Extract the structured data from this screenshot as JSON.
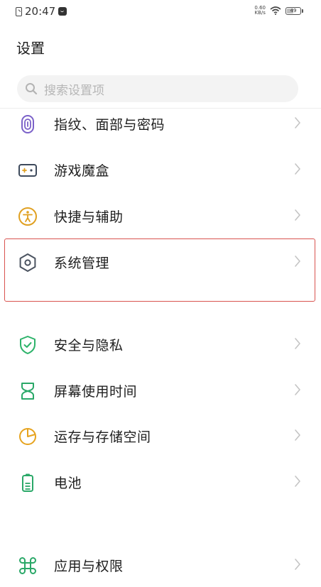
{
  "status_bar": {
    "time": "20:47",
    "net_speed_value": "0.60",
    "net_speed_unit": "KB/s",
    "battery": "49"
  },
  "page": {
    "title": "设置"
  },
  "search": {
    "placeholder": "搜索设置项"
  },
  "settings": {
    "items": [
      {
        "label": "指纹、面部与密码",
        "icon": "fingerprint-icon"
      },
      {
        "label": "游戏魔盒",
        "icon": "gamepad-icon"
      },
      {
        "label": "快捷与辅助",
        "icon": "accessibility-icon"
      },
      {
        "label": "系统管理",
        "icon": "hexagon-settings-icon",
        "highlighted": true
      },
      {
        "label": "安全与隐私",
        "icon": "shield-check-icon"
      },
      {
        "label": "屏幕使用时间",
        "icon": "hourglass-icon"
      },
      {
        "label": "运存与存储空间",
        "icon": "pie-chart-icon"
      },
      {
        "label": "电池",
        "icon": "battery-icon"
      },
      {
        "label": "应用与权限",
        "icon": "command-icon"
      }
    ]
  },
  "colors": {
    "fingerprint": "#7b61c9",
    "gamepad": "#3e4a5c",
    "accessibility": "#e0a021",
    "system": "#4b5360",
    "security": "#2db36a",
    "hourglass": "#2aa868",
    "storage": "#e6a31e",
    "battery": "#2aa868",
    "apps": "#2aa868",
    "highlight_border": "#d9534f"
  }
}
